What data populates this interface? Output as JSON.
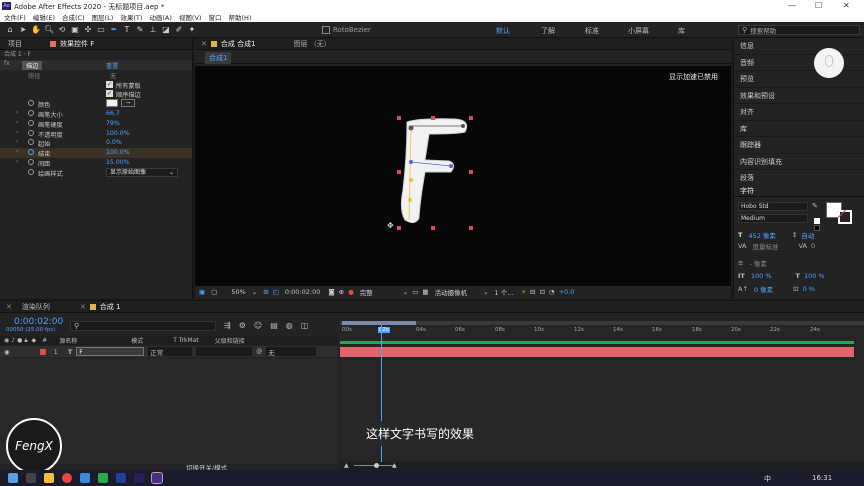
{
  "title_bar": {
    "app_icon": "Ae",
    "title": "Adobe After Effects 2020 - 无标题项目.aep *",
    "minimize": "—",
    "maximize": "☐",
    "close": "✕"
  },
  "menu": [
    "文件(F)",
    "编辑(E)",
    "合成(C)",
    "图层(L)",
    "效果(T)",
    "动画(A)",
    "视图(V)",
    "窗口",
    "帮助(H)"
  ],
  "toolbar": {
    "rotobezier": "RotoBezier",
    "workspaces": [
      "默认",
      "了解",
      "标准",
      "小屏幕",
      "库"
    ],
    "active_workspace": "默认",
    "search_placeholder": "搜索帮助"
  },
  "left_panel": {
    "tabs": [
      "项目",
      "效果控件 F"
    ],
    "breadcrumb": "合成 1 · F",
    "effect_name": "描边",
    "reset": "重置",
    "path_label": "路径",
    "path_value": "无",
    "checkbox_all_masks": "所有蒙版",
    "checkbox_sequential": "顺序描边",
    "properties": [
      {
        "label": "颜色",
        "value": "",
        "twirl": false
      },
      {
        "label": "画笔大小",
        "value": "66.7",
        "twirl": true
      },
      {
        "label": "画笔硬度",
        "value": "79%",
        "twirl": true
      },
      {
        "label": "不透明度",
        "value": "100.0%",
        "twirl": true
      },
      {
        "label": "起始",
        "value": "0.0%",
        "twirl": true
      },
      {
        "label": "结束",
        "value": "100.0%",
        "twirl": true
      },
      {
        "label": "间距",
        "value": "15.00%",
        "twirl": true
      },
      {
        "label": "绘画样式",
        "value": "显示原始图像",
        "twirl": false
      }
    ]
  },
  "comp_panel": {
    "tab": "合成 合成1",
    "layer_label": "图层 （无）",
    "subtab": "合成1",
    "notice": "显示加速已禁用",
    "letter": "F",
    "footer": {
      "zoom": "50%",
      "timecode": "0:00:02:00",
      "quality": "完整",
      "camera": "活动摄像机",
      "views": "1 个...",
      "exposure": "+0.0"
    }
  },
  "right_panel": {
    "items": [
      "信息",
      "音频",
      "预览",
      "效果和预设",
      "对齐",
      "库",
      "跟踪器",
      "内容识别填充",
      "段落"
    ],
    "character_tab": "字符",
    "font": "Hobo Std",
    "style": "Medium",
    "size": "452 像素",
    "leading": "自动",
    "kerning": "度量标准",
    "tracking": "0",
    "stroke_width": "- 像素",
    "vscale": "100 %",
    "hscale": "100 %",
    "baseline": "0 像素",
    "tsume": "0 %"
  },
  "timeline": {
    "tabs": [
      "渲染队列",
      "合成 1"
    ],
    "timecode": "0:00:02:00",
    "fps": "00050 (25.00 fps)",
    "columns": {
      "name": "源名称",
      "mode": "模式",
      "trkmat": "T  TrkMat",
      "parent": "父级和链接"
    },
    "layer": {
      "index": "1",
      "type": "T",
      "name": "F",
      "mode": "正常",
      "parent": "无"
    },
    "ruler": [
      "00s",
      "02s",
      "04s",
      "06s",
      "08s",
      "10s",
      "12s",
      "14s",
      "16s",
      "18s",
      "20s",
      "22s",
      "24s"
    ],
    "toggle": "切换开关/模式",
    "subtitle": "这样文字书写的效果"
  },
  "watermark": "FengX",
  "taskbar": {
    "time": "16:31",
    "lang": "中"
  },
  "colors": {
    "accent": "#4ea1ff",
    "layer_bar": "#e0666b",
    "timeline_bar": "#2aa84a",
    "ae_purple": "#2b1f6b"
  }
}
